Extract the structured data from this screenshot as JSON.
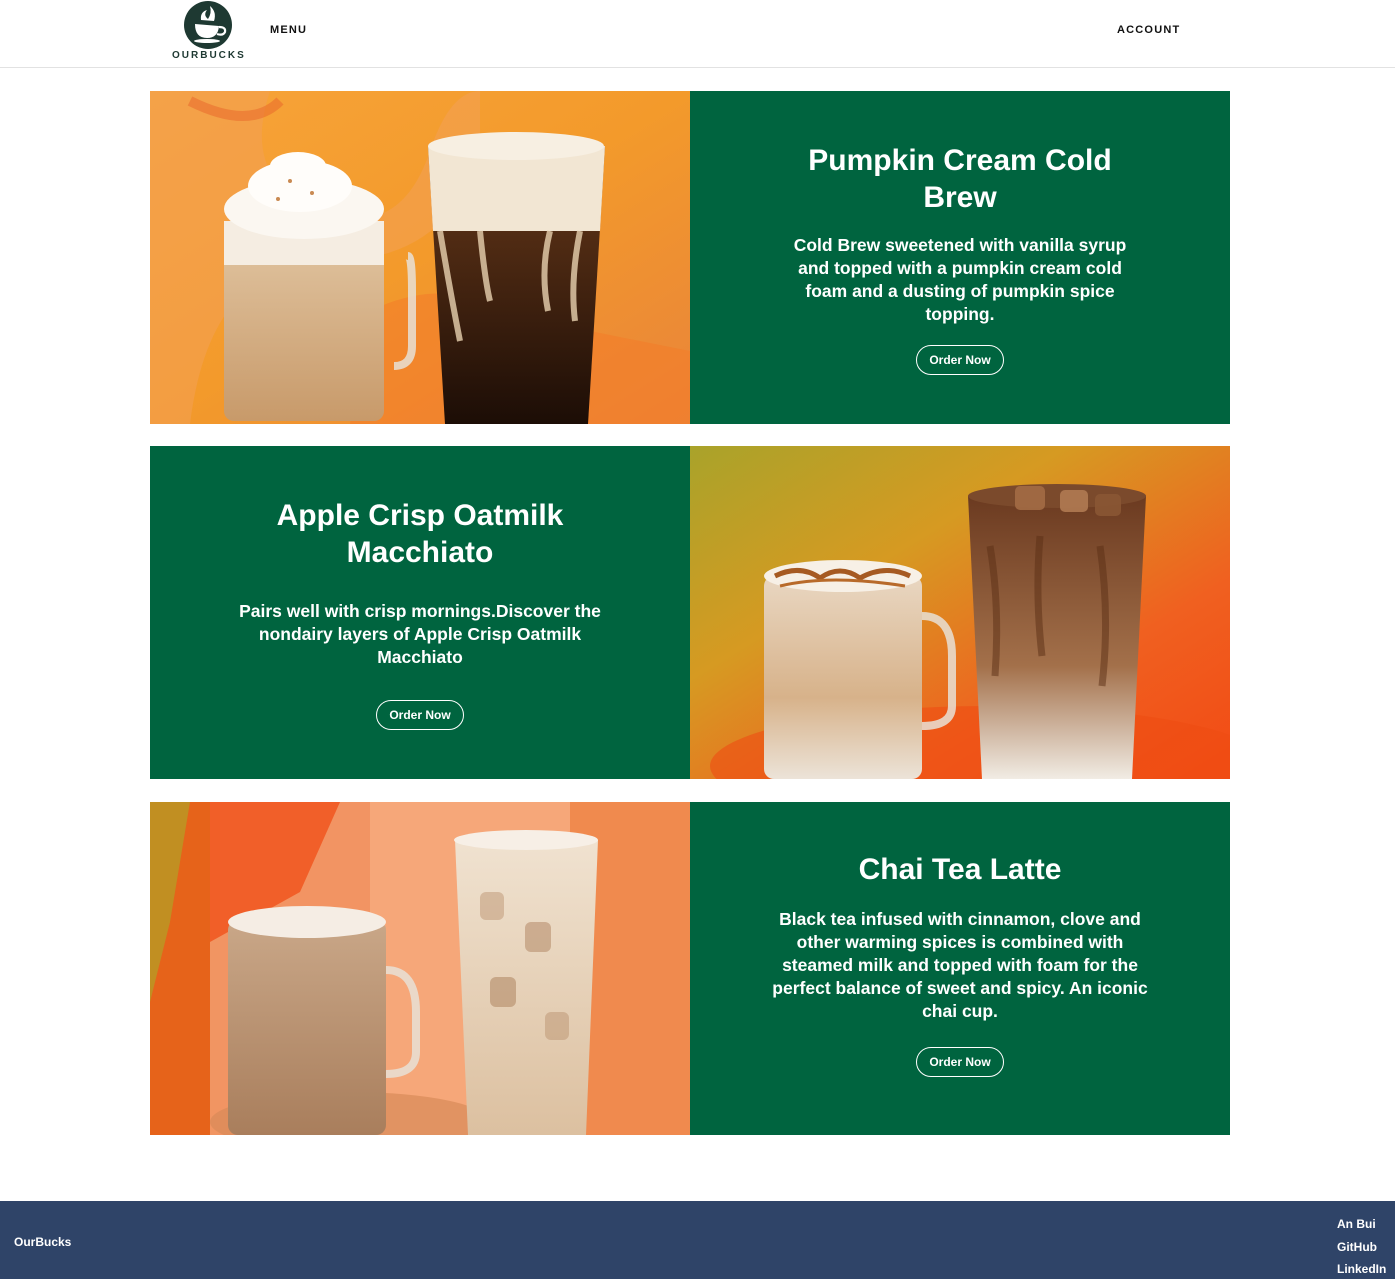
{
  "header": {
    "logo_text": "OURBUCKS",
    "menu_label": "MENU",
    "account_label": "ACCOUNT"
  },
  "promos": [
    {
      "title": "Pumpkin Cream Cold Brew",
      "description": "Cold Brew sweetened with vanilla syrup and topped with a pumpkin cream cold foam and a dusting of pumpkin spice topping.",
      "button_label": "Order Now"
    },
    {
      "title": "Apple Crisp Oatmilk Macchiato",
      "description": "Pairs well with crisp mornings.Discover the nondairy layers of Apple Crisp Oatmilk Macchiato",
      "button_label": "Order Now"
    },
    {
      "title": "Chai Tea Latte",
      "description": "Black tea infused with cinnamon, clove and other warming spices is combined with steamed milk and topped with foam for the perfect balance of sweet and spicy. An iconic chai cup.",
      "button_label": "Order Now"
    }
  ],
  "footer": {
    "brand": "OurBucks",
    "links": [
      "An Bui",
      "GitHub",
      "LinkedIn"
    ]
  },
  "colors": {
    "panel_green": "#00643f",
    "footer_navy": "#2f4468",
    "logo_dark_green": "#1e3932"
  }
}
